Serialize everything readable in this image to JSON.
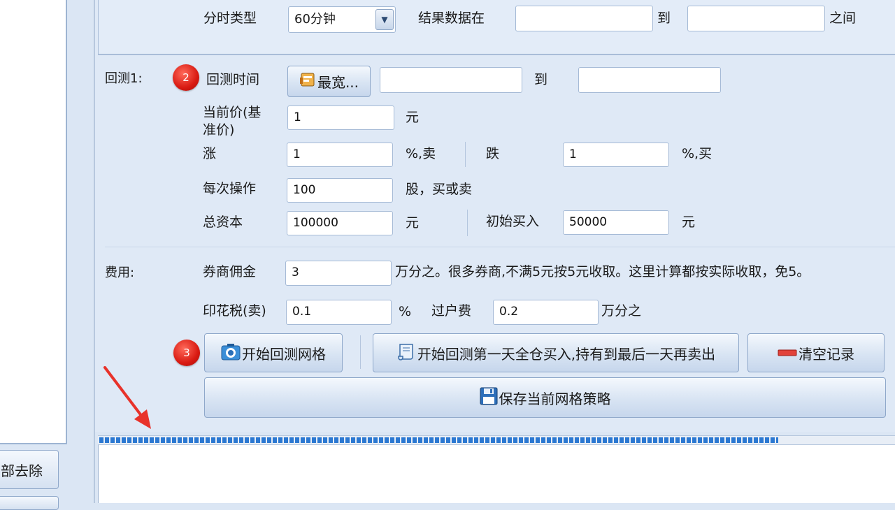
{
  "top": {
    "period_label": "分时类型",
    "period_value": "60分钟",
    "result_label": "结果数据在",
    "to_label": "到",
    "between_label": "之间",
    "result_from": "",
    "result_to": ""
  },
  "backtest": {
    "section_label": "回测1:",
    "badge2": "2",
    "time_label": "回测时间",
    "widest_button": "最宽...",
    "time_from": "",
    "to_label": "到",
    "time_to": "",
    "current_price_label_line1": "当前价(基",
    "current_price_label_line2": "准价)",
    "current_price": "1",
    "yuan_unit": "元",
    "rise_label": "涨",
    "rise_value": "1",
    "rise_unit": "%,卖",
    "fall_label": "跌",
    "fall_value": "1",
    "fall_unit": "%,买",
    "per_trade_label": "每次操作",
    "per_trade_value": "100",
    "per_trade_unit": "股，买或卖",
    "capital_label": "总资本",
    "capital_value": "100000",
    "capital_unit": "元",
    "initial_buy_label": "初始买入",
    "initial_buy_value": "50000",
    "initial_buy_unit": "元"
  },
  "fees": {
    "section_label": "费用:",
    "commission_label": "券商佣金",
    "commission_value": "3",
    "commission_note": "万分之。很多券商,不满5元按5元收取。这里计算都按实际收取，免5。",
    "stamp_tax_label": "印花税(卖)",
    "stamp_tax_value": "0.1",
    "stamp_tax_unit": "%",
    "transfer_fee_label": "过户费",
    "transfer_fee_value": "0.2",
    "transfer_fee_unit": "万分之"
  },
  "actions": {
    "badge3": "3",
    "start_grid": "开始回测网格",
    "buy_and_hold": "开始回测第一天全仓买入,持有到最后一天再卖出",
    "clear_records": "清空记录",
    "save_strategy": "保存当前网格策略"
  },
  "left": {
    "remove_all_button": "部去除"
  },
  "progress": {
    "fraction": 0.855
  },
  "colors": {
    "annotation_red": "#e8322a",
    "progress_blue": "#2b78d2"
  }
}
